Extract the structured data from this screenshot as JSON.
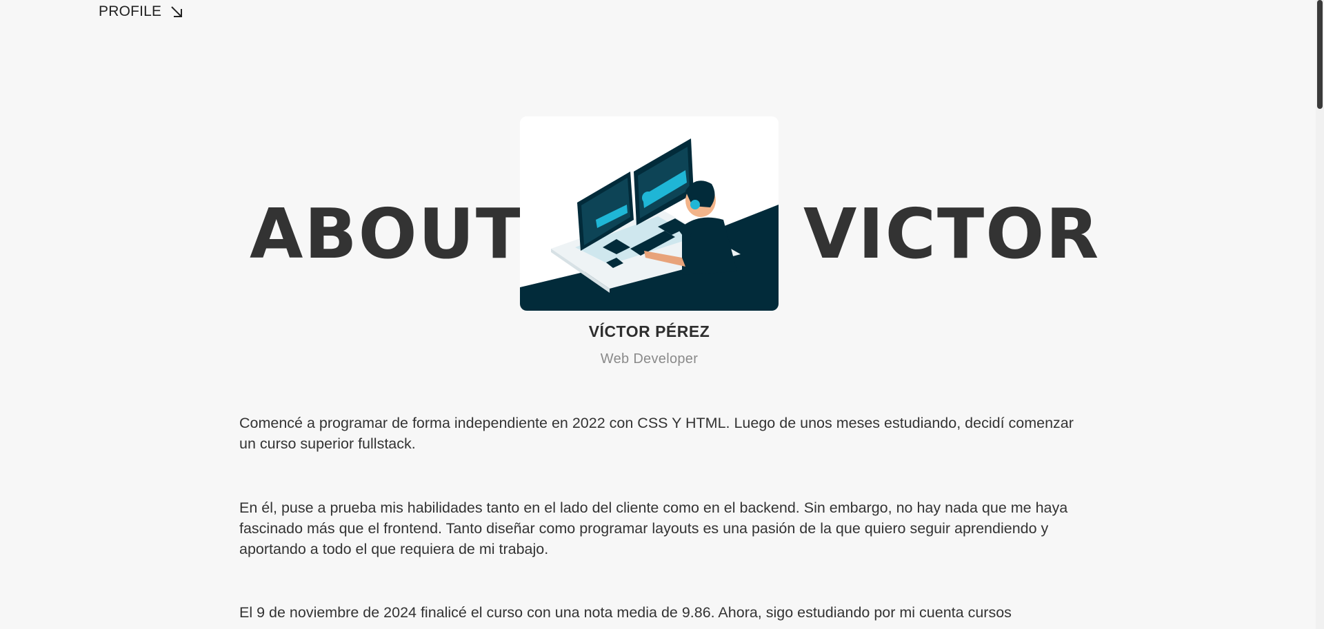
{
  "nav": {
    "profile_label": "PROFILE",
    "profile_icon": "arrow-down-right-icon"
  },
  "hero": {
    "left_word": "ABOUT",
    "right_word": "VICTOR",
    "image_icon": "developer-at-desk-illustration"
  },
  "profile": {
    "name": "VÍCTOR PÉREZ",
    "role": "Web Developer"
  },
  "bio": {
    "p1": "Comencé a programar de forma independiente en 2022 con CSS Y HTML. Luego de unos meses estudiando, decidí comenzar un curso superior fullstack.",
    "p2": "En él, puse a prueba mis habilidades tanto en el lado del cliente como en el backend. Sin embargo, no hay nada que me haya fascinado más que el frontend. Tanto diseñar como programar layouts es una pasión de la que quiero seguir aprendiendo y aportando a todo el que requiera de mi trabajo.",
    "p3": "El 9 de noviembre de 2024 finalicé el curso con una nota media de 9.86. Ahora, sigo estudiando por mi cuenta cursos"
  },
  "colors": {
    "background": "#f7f7f7",
    "text": "#333333",
    "muted": "#8a8a8a",
    "illustration_dark": "#022b3a",
    "illustration_accent": "#1fb6d6"
  }
}
